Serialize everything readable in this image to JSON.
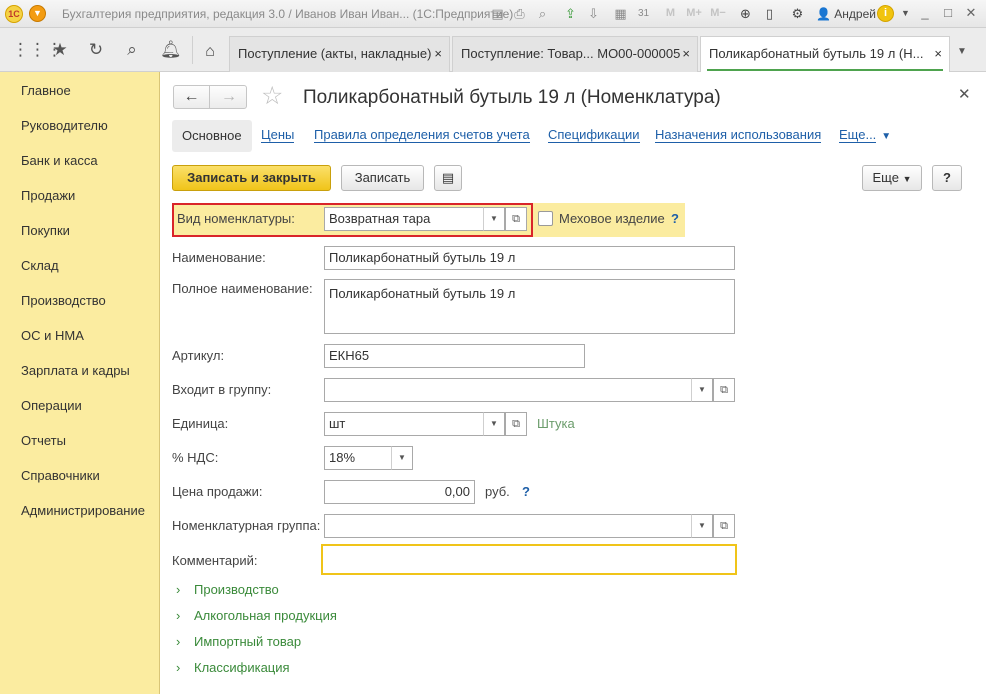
{
  "window": {
    "title": "Бухгалтерия предприятия, редакция 3.0 / Иванов Иван Иван... (1С:Предприятие)",
    "user": "Андрей",
    "toolbar_icons": [
      "save-icon",
      "print-icon",
      "print-preview-icon",
      "upload-icon",
      "download-icon",
      "calculator-icon",
      "calendar-icon",
      "memory-m-icon",
      "memory-plus-icon",
      "memory-minus-icon",
      "zoom-icon",
      "window-icon",
      "settings-icon"
    ],
    "memory_labels": {
      "m": "M",
      "mplus": "M+",
      "mminus": "M−"
    }
  },
  "tabs": [
    {
      "label": "Поступление (акты, накладные)",
      "close": "×"
    },
    {
      "label": "Поступление: Товар... МО00-000005",
      "close": "×"
    },
    {
      "label": "Поликарбонатный бутыль 19 л (Н...",
      "close": "×",
      "active": true
    }
  ],
  "sidebar": {
    "items": [
      "Главное",
      "Руководителю",
      "Банк и касса",
      "Продажи",
      "Покупки",
      "Склад",
      "Производство",
      "ОС и НМА",
      "Зарплата и кадры",
      "Операции",
      "Отчеты",
      "Справочники",
      "Администрирование"
    ]
  },
  "form": {
    "title": "Поликарбонатный бутыль 19 л (Номенклатура)",
    "subnav": {
      "active": "Основное",
      "links": [
        "Цены",
        "Правила определения счетов учета",
        "Спецификации",
        "Назначения использования"
      ],
      "more": "Еще..."
    },
    "buttons": {
      "save_close": "Записать и закрыть",
      "save": "Записать",
      "more": "Еще",
      "help": "?"
    },
    "fields": {
      "vid_label": "Вид номенклатуры:",
      "vid_value": "Возвратная тара",
      "fur_label": "Меховое изделие",
      "fur_help": "?",
      "name_label": "Наименование:",
      "name_value": "Поликарбонатный бутыль 19 л",
      "fullname_label": "Полное наименование:",
      "fullname_value": "Поликарбонатный бутыль 19 л",
      "article_label": "Артикул:",
      "article_value": "ЕКН65",
      "group_label": "Входит в группу:",
      "group_value": "",
      "unit_label": "Единица:",
      "unit_value": "шт",
      "unit_hint": "Штука",
      "vat_label": "% НДС:",
      "vat_value": "18%",
      "price_label": "Цена продажи:",
      "price_value": "0,00",
      "price_currency": "руб.",
      "price_help": "?",
      "nomgroup_label": "Номенклатурная группа:",
      "nomgroup_value": "",
      "comment_label": "Комментарий:",
      "comment_value": ""
    },
    "groups": [
      "Производство",
      "Алкогольная продукция",
      "Импортный товар",
      "Классификация"
    ]
  },
  "colors": {
    "sidebar_bg": "#fbeca0",
    "primary_button": "#f0c419",
    "link": "#1e5fa8",
    "group_link": "#3a8a3a",
    "highlight_frame": "#d9252a",
    "active_tab_underline": "#4ea34e"
  }
}
